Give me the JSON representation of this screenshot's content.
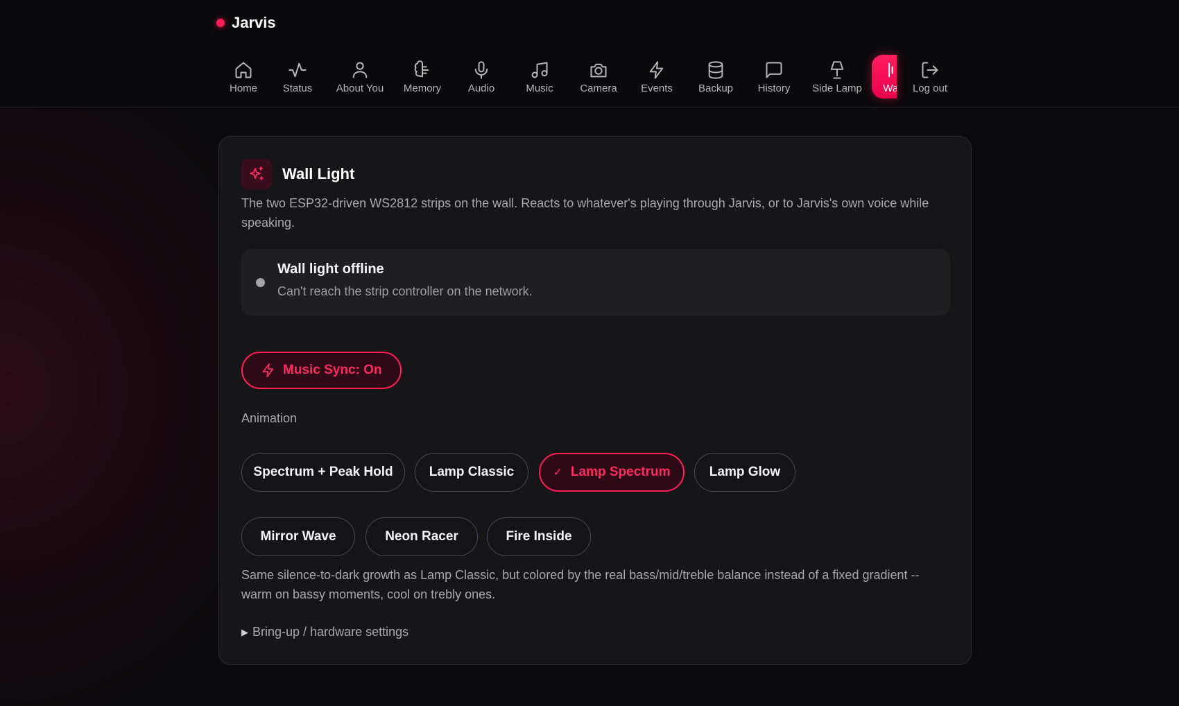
{
  "brand": {
    "name": "Jarvis"
  },
  "nav": {
    "items": [
      {
        "label": "Home",
        "icon": "home-icon"
      },
      {
        "label": "Status",
        "icon": "activity-icon"
      },
      {
        "label": "About You",
        "icon": "user-icon"
      },
      {
        "label": "Memory",
        "icon": "brain-icon"
      },
      {
        "label": "Audio",
        "icon": "microphone-icon"
      },
      {
        "label": "Music",
        "icon": "music-note-icon"
      },
      {
        "label": "Camera",
        "icon": "camera-icon"
      },
      {
        "label": "Events",
        "icon": "lightning-icon"
      },
      {
        "label": "Backup",
        "icon": "database-icon"
      },
      {
        "label": "History",
        "icon": "message-square-icon"
      },
      {
        "label": "Side Lamp",
        "icon": "lamp-icon"
      },
      {
        "label": "Wal",
        "icon": "wall-light-icon",
        "active": true
      },
      {
        "label": "Log out",
        "icon": "log-out-icon"
      }
    ]
  },
  "card": {
    "title": "Wall Light",
    "icon": "sparkles-icon",
    "description": "The two ESP32-driven WS2812 strips on the wall. Reacts to whatever's playing through Jarvis, or to Jarvis's own voice while speaking.",
    "status": {
      "title": "Wall light offline",
      "subtitle": "Can't reach the strip controller on the network."
    },
    "music_sync": {
      "label": "Music Sync: On",
      "icon": "lightning-icon"
    },
    "animation": {
      "label": "Animation",
      "options": [
        {
          "label": "Spectrum + Peak Hold",
          "selected": false
        },
        {
          "label": "Lamp Classic",
          "selected": false
        },
        {
          "label": "Lamp Spectrum",
          "selected": true
        },
        {
          "label": "Lamp Glow",
          "selected": false
        },
        {
          "label": "Mirror Wave",
          "selected": false
        },
        {
          "label": "Neon Racer",
          "selected": false
        },
        {
          "label": "Fire Inside",
          "selected": false
        }
      ],
      "description": "Same silence-to-dark growth as Lamp Classic, but colored by the real bass/mid/treble balance instead of a fixed gradient -- warm on bassy moments, cool on trebly ones."
    },
    "bringup_label": "Bring-up / hardware settings"
  },
  "colors": {
    "accent": "#ff1f55",
    "background": "#0b0a0c",
    "card": "#161518",
    "muted_text": "#a9a8ae"
  }
}
